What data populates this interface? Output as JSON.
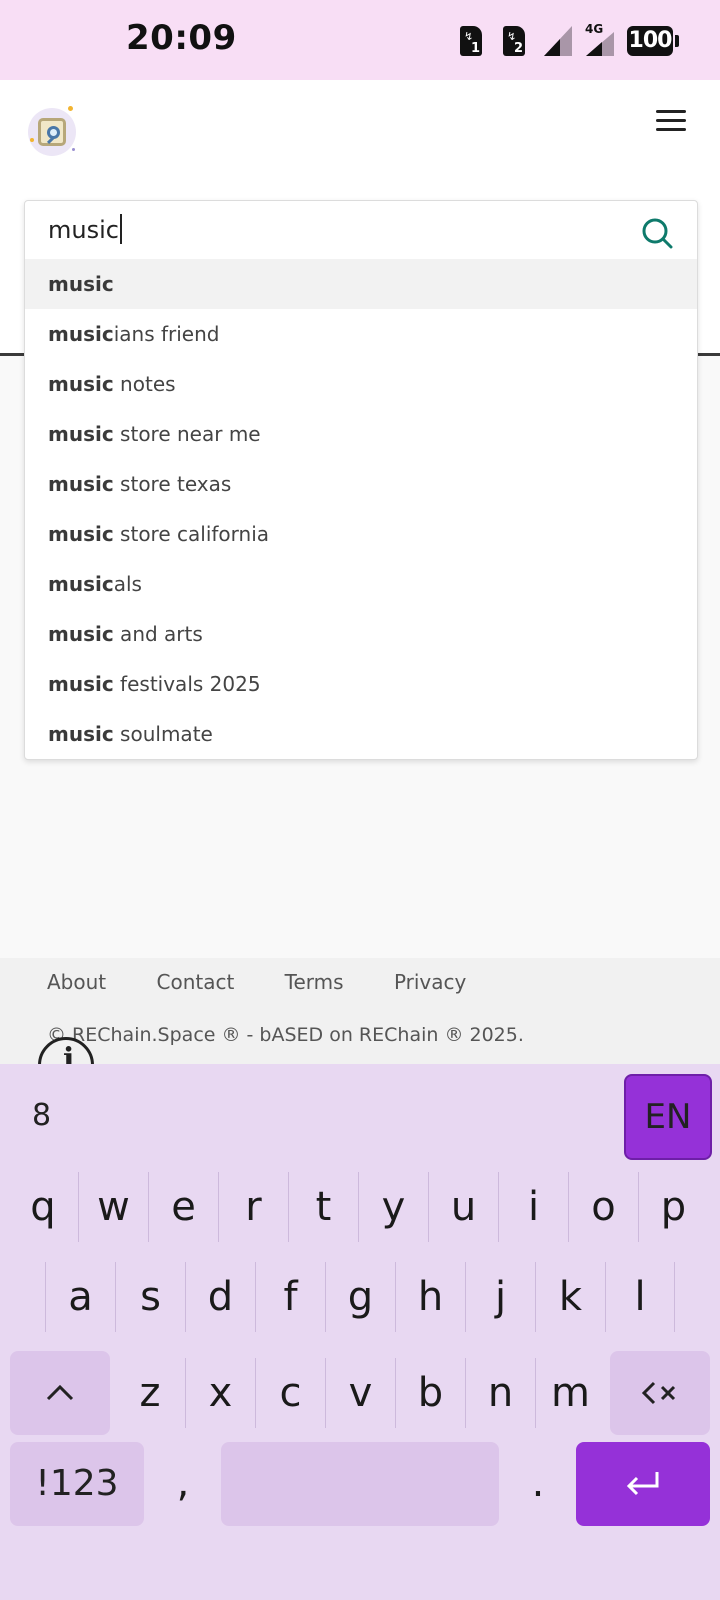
{
  "status_bar": {
    "time": "20:09",
    "sim1_label": "1",
    "sim2_label": "2",
    "network_type": "4G",
    "battery": "100"
  },
  "header": {
    "logo_icon": "magnifier-logo-icon",
    "menu_icon": "hamburger-menu-icon"
  },
  "search": {
    "query": "music",
    "icon": "search-icon",
    "icon_color": "#0e7a6b"
  },
  "suggestions": [
    {
      "bold": "music",
      "rest": ""
    },
    {
      "bold": "music",
      "rest": "ians friend"
    },
    {
      "bold": "music",
      "rest": " notes"
    },
    {
      "bold": "music",
      "rest": " store near me"
    },
    {
      "bold": "music",
      "rest": " store texas"
    },
    {
      "bold": "music",
      "rest": " store california"
    },
    {
      "bold": "music",
      "rest": "als"
    },
    {
      "bold": "music",
      "rest": " and arts"
    },
    {
      "bold": "music",
      "rest": " festivals 2025"
    },
    {
      "bold": "music",
      "rest": " soulmate"
    }
  ],
  "footer": {
    "links": [
      "About",
      "Contact",
      "Terms",
      "Privacy"
    ],
    "copyright": "© REChain.Space ® - bASED on REChain ® 2025."
  },
  "keyboard": {
    "suggestion": "8",
    "language": "EN",
    "row1": [
      "q",
      "w",
      "e",
      "r",
      "t",
      "y",
      "u",
      "i",
      "o",
      "p"
    ],
    "row2": [
      "a",
      "s",
      "d",
      "f",
      "g",
      "h",
      "j",
      "k",
      "l"
    ],
    "row3": [
      "z",
      "x",
      "c",
      "v",
      "b",
      "n",
      "m"
    ],
    "symbols_label": "!123",
    "comma": ",",
    "period": ".",
    "accent_color": "#9531d8"
  }
}
